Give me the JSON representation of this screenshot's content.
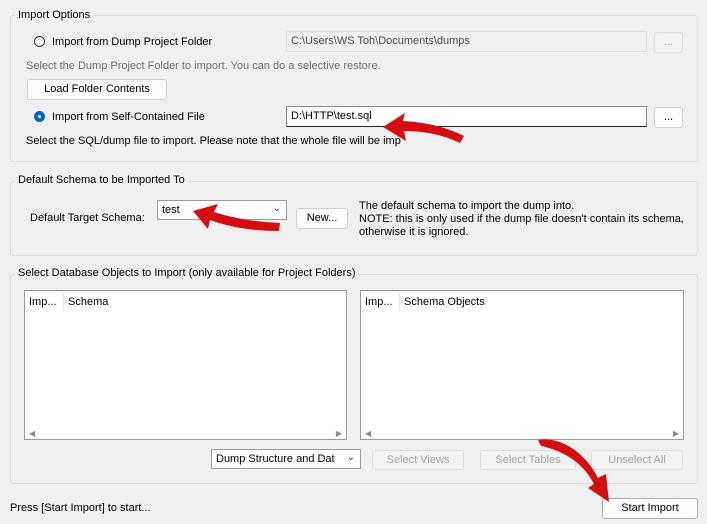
{
  "import_options": {
    "legend": "Import Options",
    "dump_folder_radio_label": "Import from Dump Project Folder",
    "dump_folder_path": "C:\\Users\\WS Toh\\Documents\\dumps",
    "dump_folder_browse": "...",
    "dump_folder_hint": "Select the Dump Project Folder to import. You can do a selective restore.",
    "load_folder_button": "Load Folder Contents",
    "self_contained_radio_label": "Import from Self-Contained File",
    "self_contained_path": "D:\\HTTP\\test.sql",
    "self_contained_browse": "...",
    "self_contained_hint": "Select the SQL/dump file to import. Please note that the whole file will be imp"
  },
  "default_schema": {
    "legend": "Default Schema to be Imported To",
    "target_label": "Default Target Schema:",
    "target_value": "test",
    "new_button": "New...",
    "note_line1": "The default schema to import the dump into.",
    "note_line2": "NOTE: this is only used if the dump file doesn't contain its schema,",
    "note_line3": "otherwise it is ignored."
  },
  "db_objects": {
    "legend": "Select Database Objects to Import (only available for Project Folders)",
    "left_list_columns": [
      "Imp...",
      "Schema"
    ],
    "right_list_columns": [
      "Imp...",
      "Schema Objects"
    ],
    "dump_type_value": "Dump Structure and Dat",
    "select_views": "Select Views",
    "select_tables": "Select Tables",
    "unselect_all": "Unselect All"
  },
  "footer": {
    "status": "Press [Start Import] to start...",
    "start_import": "Start Import"
  },
  "colors": {
    "annotation_arrow": "#d40d12",
    "accent": "#0067c0"
  },
  "icons": {
    "combo_arrow": "chevron-down-icon",
    "scroll_left": "scroll-left-icon",
    "scroll_right": "scroll-right-icon"
  }
}
